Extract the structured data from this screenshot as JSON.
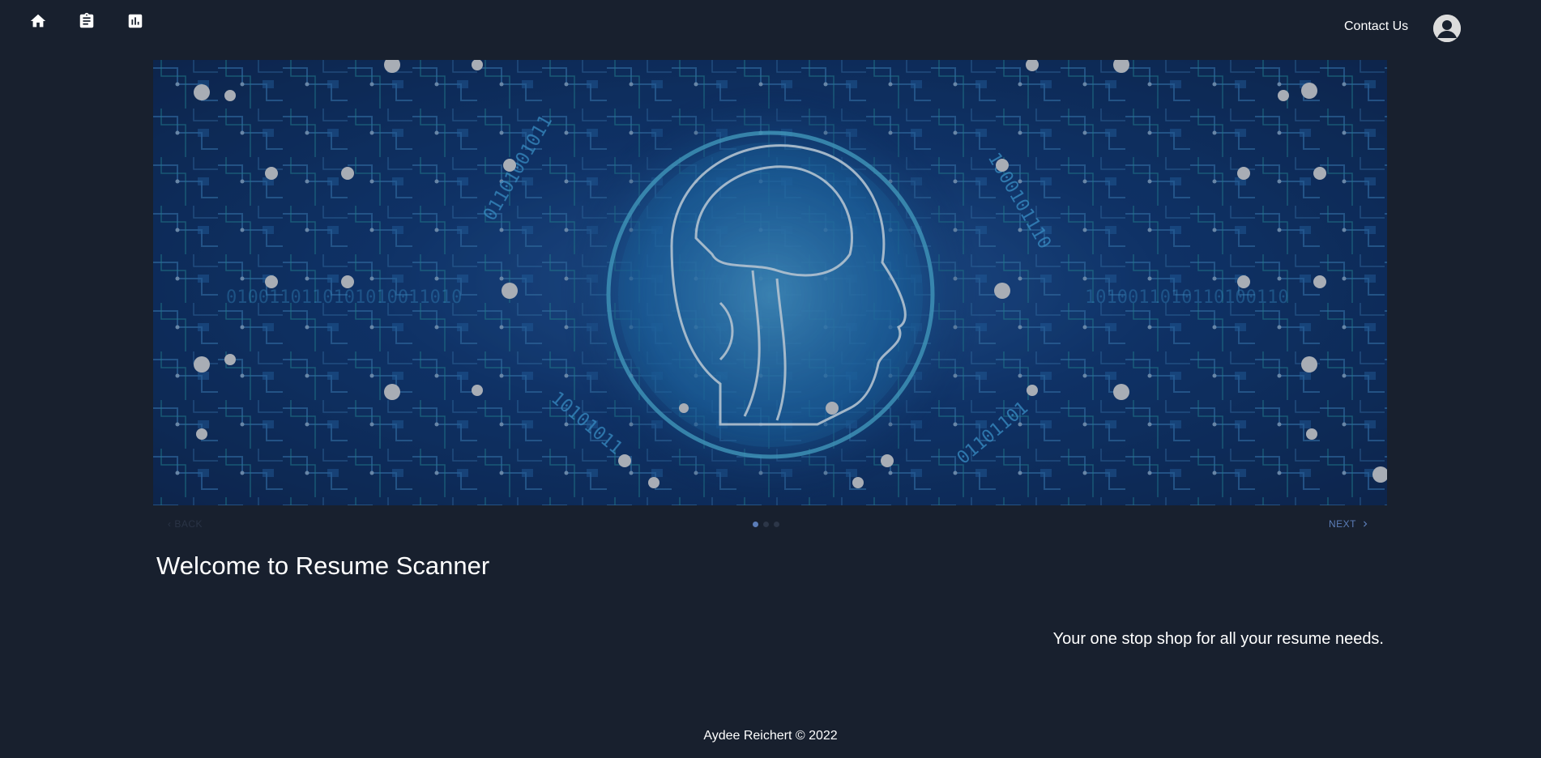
{
  "nav": {
    "icons": [
      "home-icon",
      "clipboard-icon",
      "bar-chart-icon"
    ],
    "contact_label": "Contact Us",
    "avatar_icon": "account-circle-icon"
  },
  "carousel": {
    "image_description": "ai-brain-circuit-banner",
    "back_label": "BACK",
    "next_label": "NEXT",
    "dot_count": 3,
    "active_index": 0
  },
  "main": {
    "title": "Welcome to Resume Scanner",
    "tagline": "Your one stop shop for all your resume needs."
  },
  "footer": {
    "text": "Aydee Reichert © 2022"
  },
  "colors": {
    "background": "#18202e",
    "accent": "#5b7db8",
    "circuit_blue": "#1a5bb8"
  }
}
